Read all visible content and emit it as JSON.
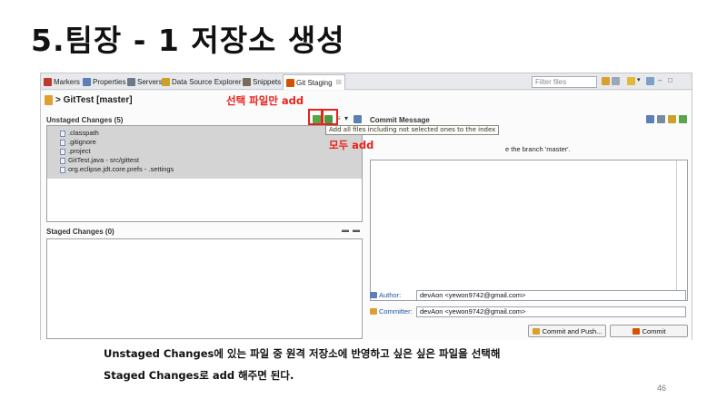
{
  "slide": {
    "title": "5.팀장 - 1 저장소 생성",
    "caption_line1": "Unstaged Changes에 있는 파일 중 원격 저장소에 반영하고 싶은 싶은 파일을 선택해",
    "caption_line2": "Staged Changes로 add 해주면 된다.",
    "page_number": "46",
    "annotation_selected_add": "선택 파일만 add",
    "annotation_all_add": "모두 add",
    "annotation_color": "#e8221b"
  },
  "view_tabs": [
    {
      "label": "Markers",
      "icon": "markers-icon",
      "color": "#c0392b"
    },
    {
      "label": "Properties",
      "icon": "properties-icon",
      "color": "#5b7fb6"
    },
    {
      "label": "Servers",
      "icon": "servers-icon",
      "color": "#6a7a8a"
    },
    {
      "label": "Data Source Explorer",
      "icon": "data-source-icon",
      "color": "#c9a227"
    },
    {
      "label": "Snippets",
      "icon": "snippets-icon",
      "color": "#7a6a5a"
    },
    {
      "label": "Git Staging",
      "icon": "git-staging-icon",
      "color": "#d35400",
      "active": true,
      "close": "☒"
    }
  ],
  "filter_placeholder": "Filter files",
  "repository": {
    "title": "> GitTest [master]"
  },
  "unstaged": {
    "title": "Unstaged Changes (5)",
    "files": [
      ".classpath",
      ".gitignore",
      ".project",
      "GitTest.java - src/gittest",
      "org.eclipse.jdt.core.prefs - .settings"
    ]
  },
  "staged": {
    "title": "Staged Changes (0)",
    "files": []
  },
  "tooltip": "Add all files including not selected ones to the index",
  "commit": {
    "title": "Commit Message",
    "hint": "e the branch 'master'.",
    "author_label": "Author:",
    "author_value": "devAon <yewon9742@gmail.com>",
    "committer_label": "Committer:",
    "committer_value": "devAon <yewon9742@gmail.com>",
    "commit_push_label": "Commit and Push...",
    "commit_label": "Commit"
  }
}
